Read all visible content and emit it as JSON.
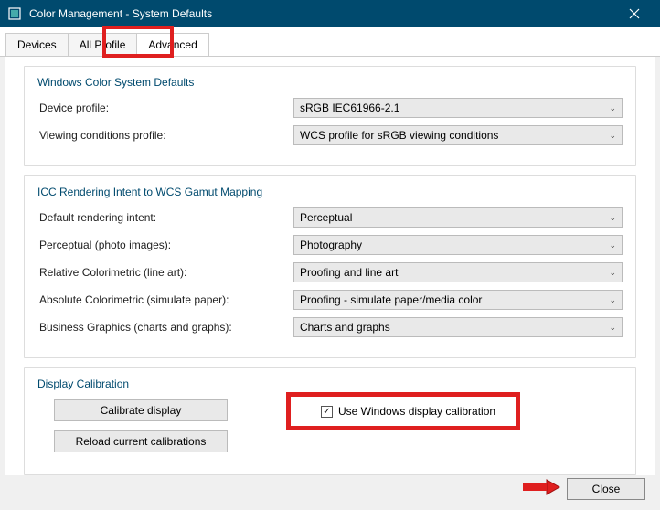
{
  "titlebar": {
    "title": "Color Management - System Defaults"
  },
  "tabs": {
    "devices": "Devices",
    "all_profiles": "All Profile",
    "advanced": "Advanced"
  },
  "wcs_group": {
    "title": "Windows Color System Defaults",
    "device_profile_label": "Device profile:",
    "device_profile_value": "sRGB IEC61966-2.1",
    "viewing_conditions_label": "Viewing conditions profile:",
    "viewing_conditions_value": "WCS profile for sRGB viewing conditions"
  },
  "icc_group": {
    "title": "ICC Rendering Intent to WCS Gamut Mapping",
    "default_intent_label": "Default rendering intent:",
    "default_intent_value": "Perceptual",
    "perceptual_label": "Perceptual (photo images):",
    "perceptual_value": "Photography",
    "relative_label": "Relative Colorimetric (line art):",
    "relative_value": "Proofing and line art",
    "absolute_label": "Absolute Colorimetric (simulate paper):",
    "absolute_value": "Proofing - simulate paper/media color",
    "business_label": "Business Graphics (charts and graphs):",
    "business_value": "Charts and graphs"
  },
  "calib_group": {
    "title": "Display Calibration",
    "calibrate_btn": "Calibrate display",
    "reload_btn": "Reload current calibrations",
    "checkbox_label": "Use Windows display calibration",
    "checkbox_checked": true
  },
  "footer": {
    "close_btn": "Close"
  }
}
